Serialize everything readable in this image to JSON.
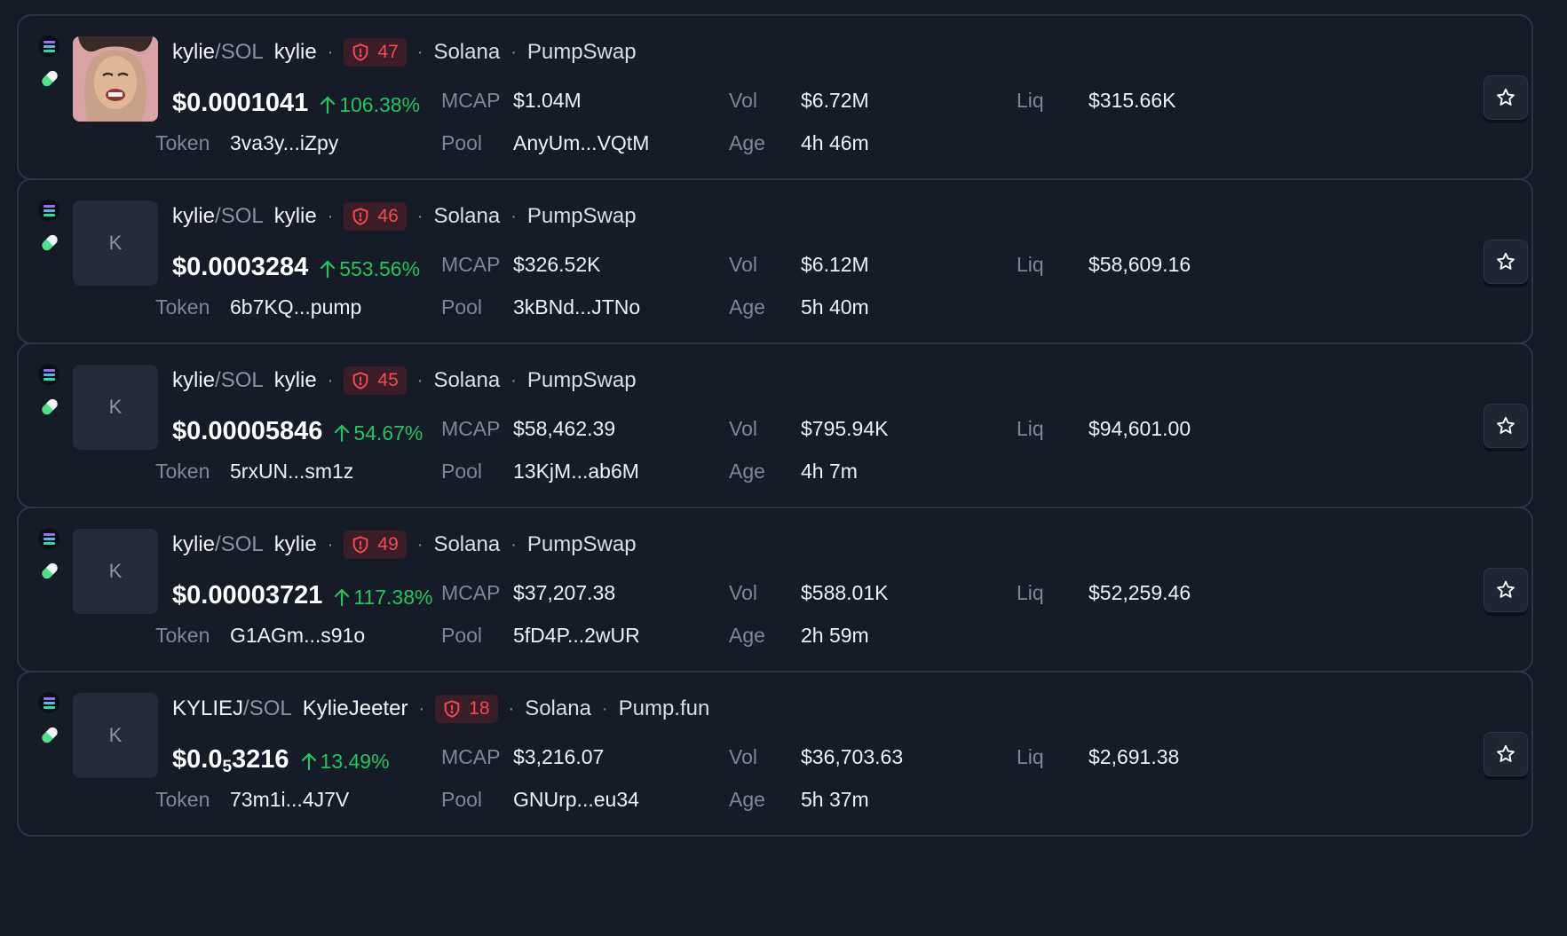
{
  "labels": {
    "mcap": "MCAP",
    "vol": "Vol",
    "liq": "Liq",
    "token": "Token",
    "pool": "Pool",
    "age": "Age",
    "sep": "/",
    "dot": "·"
  },
  "colors": {
    "positive": "#22c55e",
    "risk_badge_text": "#f04a55",
    "risk_badge_bg": "#3b1d27"
  },
  "icons": {
    "chain": "solana-icon",
    "launchpad": "pill-icon",
    "risk": "shield-icon",
    "change": "arrow-up-icon",
    "favorite": "star-icon"
  },
  "tokens": [
    {
      "base": "kylie",
      "quote": "SOL",
      "name": "kylie",
      "risk": "47",
      "chain": "Solana",
      "dex": "PumpSwap",
      "price_main": "$0.0001041",
      "price_sub": "",
      "price_tail": "",
      "change": "106.38%",
      "mcap": "$1.04M",
      "vol": "$6.72M",
      "liq": "$315.66K",
      "token": "3va3y...iZpy",
      "pool": "AnyUm...VQtM",
      "age": "4h 46m",
      "avatar": "image",
      "avatar_letter": ""
    },
    {
      "base": "kylie",
      "quote": "SOL",
      "name": "kylie",
      "risk": "46",
      "chain": "Solana",
      "dex": "PumpSwap",
      "price_main": "$0.0003284",
      "price_sub": "",
      "price_tail": "",
      "change": "553.56%",
      "mcap": "$326.52K",
      "vol": "$6.12M",
      "liq": "$58,609.16",
      "token": "6b7KQ...pump",
      "pool": "3kBNd...JTNo",
      "age": "5h 40m",
      "avatar": "letter",
      "avatar_letter": "K"
    },
    {
      "base": "kylie",
      "quote": "SOL",
      "name": "kylie",
      "risk": "45",
      "chain": "Solana",
      "dex": "PumpSwap",
      "price_main": "$0.00005846",
      "price_sub": "",
      "price_tail": "",
      "change": "54.67%",
      "mcap": "$58,462.39",
      "vol": "$795.94K",
      "liq": "$94,601.00",
      "token": "5rxUN...sm1z",
      "pool": "13KjM...ab6M",
      "age": "4h 7m",
      "avatar": "letter",
      "avatar_letter": "K"
    },
    {
      "base": "kylie",
      "quote": "SOL",
      "name": "kylie",
      "risk": "49",
      "chain": "Solana",
      "dex": "PumpSwap",
      "price_main": "$0.00003721",
      "price_sub": "",
      "price_tail": "",
      "change": "117.38%",
      "mcap": "$37,207.38",
      "vol": "$588.01K",
      "liq": "$52,259.46",
      "token": "G1AGm...s91o",
      "pool": "5fD4P...2wUR",
      "age": "2h 59m",
      "avatar": "letter",
      "avatar_letter": "K"
    },
    {
      "base": "KYLIEJ",
      "quote": "SOL",
      "name": "KylieJeeter",
      "risk": "18",
      "chain": "Solana",
      "dex": "Pump.fun",
      "price_main": "$0.0",
      "price_sub": "5",
      "price_tail": "3216",
      "change": "13.49%",
      "mcap": "$3,216.07",
      "vol": "$36,703.63",
      "liq": "$2,691.38",
      "token": "73m1i...4J7V",
      "pool": "GNUrp...eu34",
      "age": "5h 37m",
      "avatar": "letter",
      "avatar_letter": "K"
    }
  ]
}
